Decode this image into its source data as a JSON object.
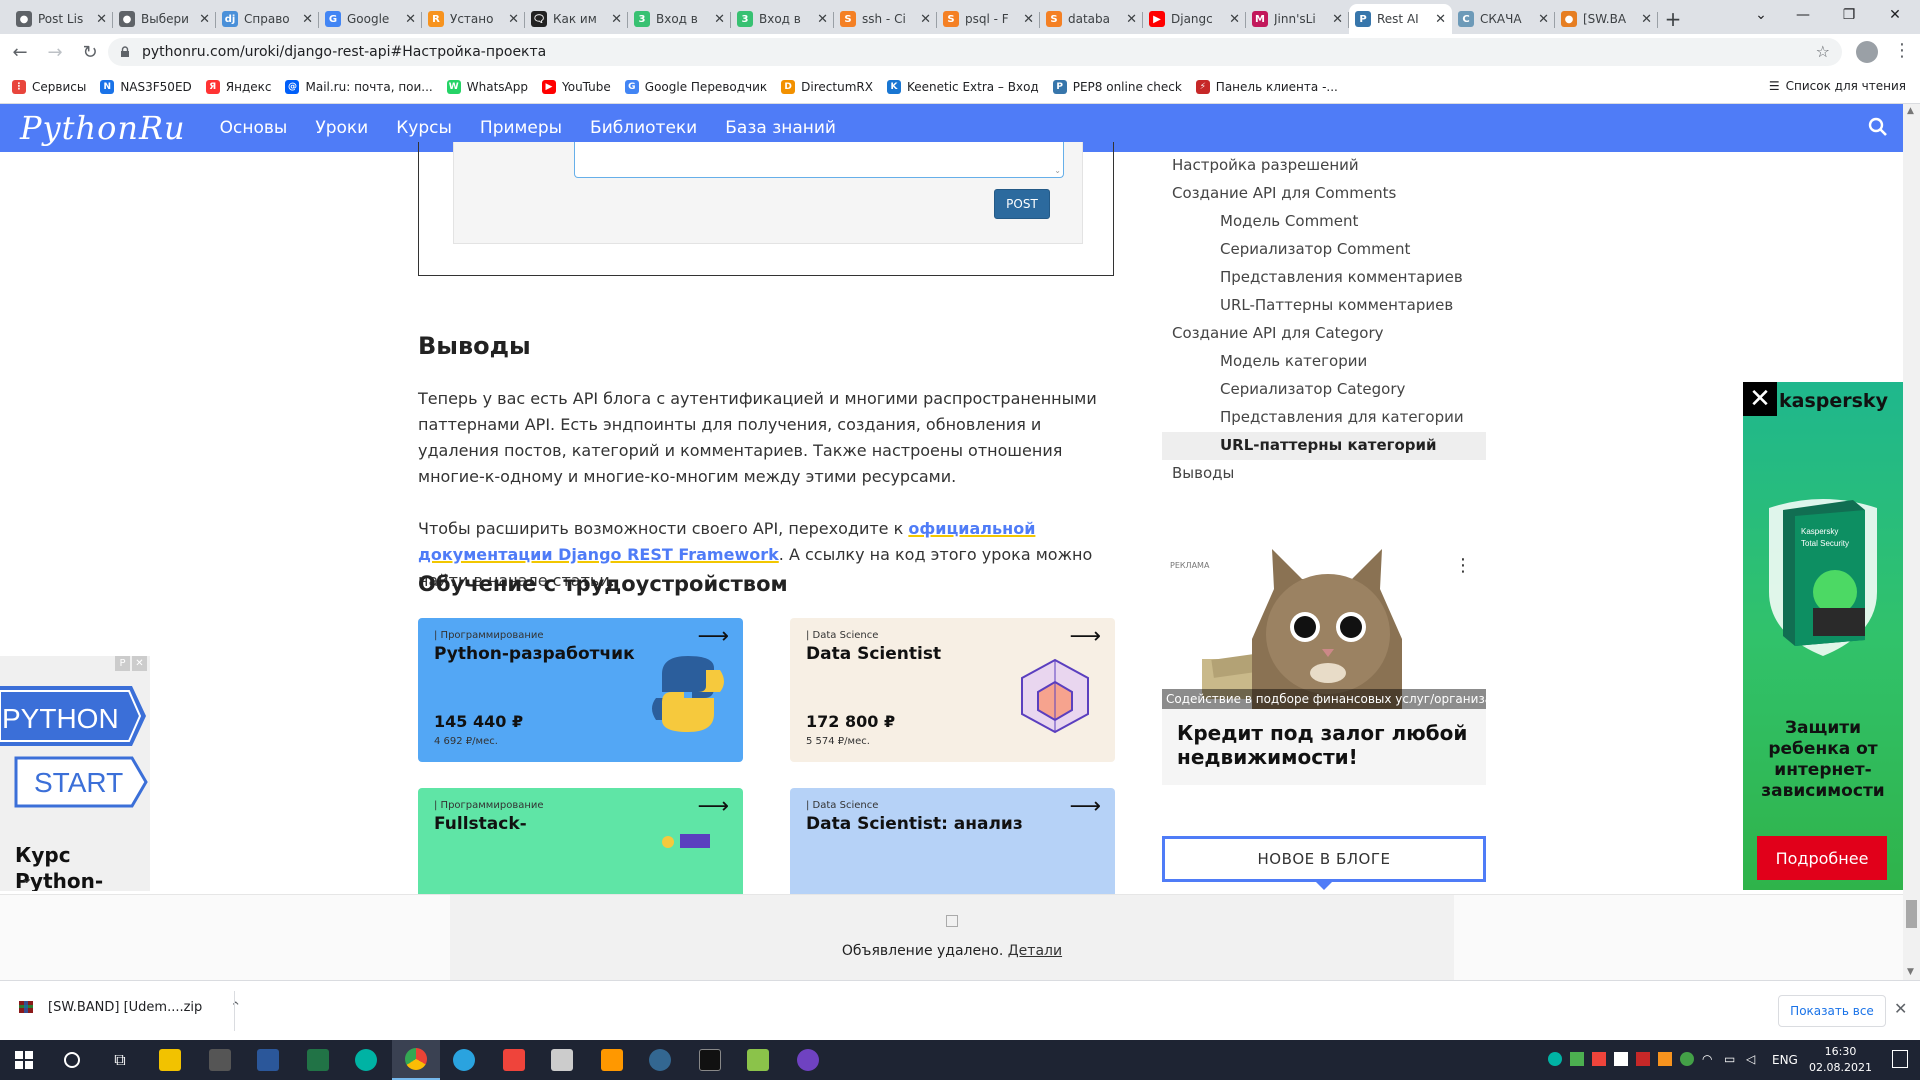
{
  "browser": {
    "tabs": [
      {
        "title": "Post Lis",
        "color": "#5f6368",
        "glyph": "●"
      },
      {
        "title": "Выбери",
        "color": "#5f6368",
        "glyph": "●"
      },
      {
        "title": "Справо",
        "color": "#4a90d9",
        "glyph": "dj"
      },
      {
        "title": "Google",
        "color": "#4285f4",
        "glyph": "G"
      },
      {
        "title": "Устано",
        "color": "#f7931e",
        "glyph": "R"
      },
      {
        "title": "Как им",
        "color": "#222222",
        "glyph": "🗨"
      },
      {
        "title": "Вход в",
        "color": "#38c172",
        "glyph": "3"
      },
      {
        "title": "Вход в",
        "color": "#38c172",
        "glyph": "3"
      },
      {
        "title": "ssh - Ci",
        "color": "#f48024",
        "glyph": "S"
      },
      {
        "title": "psql - F",
        "color": "#f48024",
        "glyph": "S"
      },
      {
        "title": "databa",
        "color": "#f48024",
        "glyph": "S"
      },
      {
        "title": "Djangc",
        "color": "#ff0000",
        "glyph": "▶"
      },
      {
        "title": "Jinn'sLi",
        "color": "#c2185b",
        "glyph": "M"
      },
      {
        "title": "Rest AI",
        "color": "#3776ab",
        "glyph": "P",
        "active": true
      },
      {
        "title": "СКАЧА",
        "color": "#6d9ab8",
        "glyph": "C"
      },
      {
        "title": "[SW.BA",
        "color": "#e67e22",
        "glyph": "●"
      }
    ],
    "url": "pythonru.com/uroki/django-rest-api#Настройка-проекта",
    "bookmarks": [
      {
        "label": "Сервисы",
        "color": "#e8453c",
        "glyph": "⋮"
      },
      {
        "label": "NAS3F50ED",
        "color": "#1a73e8",
        "glyph": "N"
      },
      {
        "label": "Яндекс",
        "color": "#f33",
        "glyph": "Я"
      },
      {
        "label": "Mail.ru: почта, пои...",
        "color": "#005ff9",
        "glyph": "@"
      },
      {
        "label": "WhatsApp",
        "color": "#25d366",
        "glyph": "W"
      },
      {
        "label": "YouTube",
        "color": "#ff0000",
        "glyph": "▶"
      },
      {
        "label": "Google Переводчик",
        "color": "#4285f4",
        "glyph": "G"
      },
      {
        "label": "DirectumRX",
        "color": "#f29100",
        "glyph": "D"
      },
      {
        "label": "Keenetic Extra – Вход",
        "color": "#1976d2",
        "glyph": "K"
      },
      {
        "label": "PEP8 online check",
        "color": "#3776ab",
        "glyph": "P"
      },
      {
        "label": "Панель клиента -...",
        "color": "#c62828",
        "glyph": "⚡"
      }
    ],
    "reading_list": "Список для чтения"
  },
  "site": {
    "logo": "PythonRu",
    "menu": [
      "Основы",
      "Уроки",
      "Курсы",
      "Примеры",
      "Библиотеки",
      "База знаний"
    ]
  },
  "article": {
    "post_button": "POST",
    "conclusions_title": "Выводы",
    "p1": "Теперь у вас есть API блога с аутентификацией и многими распространенными паттернами API. Есть эндпоинты для получения, создания, обновления и удаления постов, категорий и комментариев. Также настроены отношения многие-к-одному и многие-ко-многим между этими ресурсами.",
    "p2_before": "Чтобы расширить возможности своего API, переходите к ",
    "p2_link": "официальной документации Django REST Framework",
    "p2_after": ". А ссылку на код этого урока можно найти в начале статьи.",
    "jobs_title": "Обучение с трудоустройством",
    "cards": [
      {
        "category": "| Программирование",
        "title": "Python-разработчик",
        "price": "145 440 ₽",
        "monthly": "4 692 ₽/мес.",
        "bg": "#53a7f5"
      },
      {
        "category": "| Data Science",
        "title": "Data Scientist",
        "price": "172 800 ₽",
        "monthly": "5 574 ₽/мес.",
        "bg": "#f7efe4"
      },
      {
        "category": "| Программирование",
        "title": "Fullstack-",
        "price": "",
        "monthly": "",
        "bg": "#5fe5a6"
      },
      {
        "category": "| Data Science",
        "title": "Data Scientist: анализ",
        "price": "",
        "monthly": "",
        "bg": "#b6d2f7"
      }
    ]
  },
  "toc": [
    {
      "label": "Настройка разрешений",
      "level": 1
    },
    {
      "label": "Создание API для Comments",
      "level": 1
    },
    {
      "label": "Модель Comment",
      "level": 2
    },
    {
      "label": "Сериализатор Comment",
      "level": 2
    },
    {
      "label": "Представления комментариев",
      "level": 2
    },
    {
      "label": "URL-Паттерны комментариев",
      "level": 2
    },
    {
      "label": "Создание API для Category",
      "level": 1
    },
    {
      "label": "Модель категории",
      "level": 2
    },
    {
      "label": "Сериализатор Category",
      "level": 2
    },
    {
      "label": "Представления для категории",
      "level": 2
    },
    {
      "label": "URL-паттерны категорий",
      "level": 2,
      "active": true
    },
    {
      "label": "Выводы",
      "level": 1
    }
  ],
  "sidebar_ad": {
    "label": "РЕКЛАМА",
    "caption": "Содействие в подборе финансовых услуг/организаций",
    "title": "Кредит под залог любой недвижимости!"
  },
  "new_in_blog": "НОВОЕ В БЛОГЕ",
  "right_ad": {
    "brand": "kaspersky",
    "text": "Защити ребенка от интернет-зависимости",
    "button": "Подробнее",
    "box_line1": "Kaspersky",
    "box_line2": "Total Security"
  },
  "left_ad": {
    "line1": "PYTHON",
    "line2": "START",
    "title": "Курс Python-",
    "report": "P",
    "close": "✕"
  },
  "ad_removed": {
    "text": "Объявление удалено. ",
    "link": "Детали"
  },
  "downloads": {
    "file": "[SW.BAND] [Udem....zip",
    "show_all": "Показать все"
  },
  "taskbar": {
    "lang": "ENG",
    "time": "16:30",
    "date": "02.08.2021"
  }
}
